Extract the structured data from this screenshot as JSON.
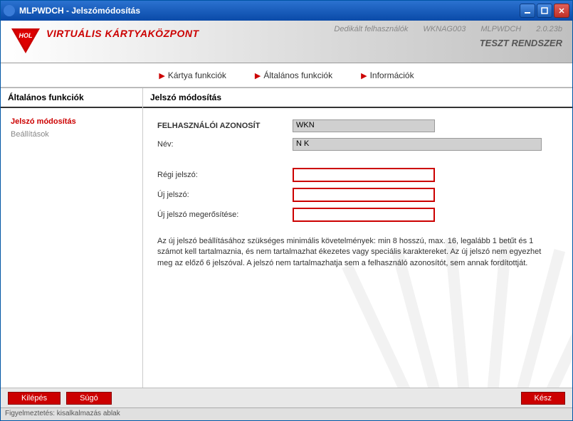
{
  "window": {
    "title": "MLPWDCH - Jelszómódosítás"
  },
  "header": {
    "brand": "VIRTUÁLIS KÁRTYAKÖZPONT",
    "user_label": "Dedikált felhasználók",
    "user_value": "WKNAG003",
    "app": "MLPWDCH",
    "version": "2.0.23b",
    "test_label": "TESZT RENDSZER"
  },
  "topnav": {
    "item1": "Kártya funkciók",
    "item2": "Általános funkciók",
    "item3": "Információk"
  },
  "sidebar": {
    "title": "Általános funkciók",
    "items": {
      "password": "Jelszó módosítás",
      "settings": "Beállítások"
    }
  },
  "main": {
    "title": "Jelszó módosítás",
    "labels": {
      "userid": "FELHASZNÁLÓI AZONOSÍT",
      "name": "Név:",
      "old_pw": "Régi jelszó:",
      "new_pw": "Új jelszó:",
      "confirm_pw": "Új jelszó megerősítése:"
    },
    "values": {
      "userid": "WKN",
      "name": "N    K"
    },
    "helptext": "Az új jelszó beállításához szükséges minimális követelmények: min 8 hosszú, max. 16, legalább 1 betűt és 1 számot kell tartalmaznia, és nem tartalmazhat ékezetes vagy speciális karaktereket. Az új jelszó nem egyezhet meg az előző 6 jelszóval. A jelszó nem tartalmazhatja sem a felhasználó azonosítót, sem annak fordítottját."
  },
  "buttons": {
    "exit": "Kilépés",
    "help": "Súgó",
    "done": "Kész"
  },
  "status": "Figyelmeztetés: kisalkalmazás ablak"
}
